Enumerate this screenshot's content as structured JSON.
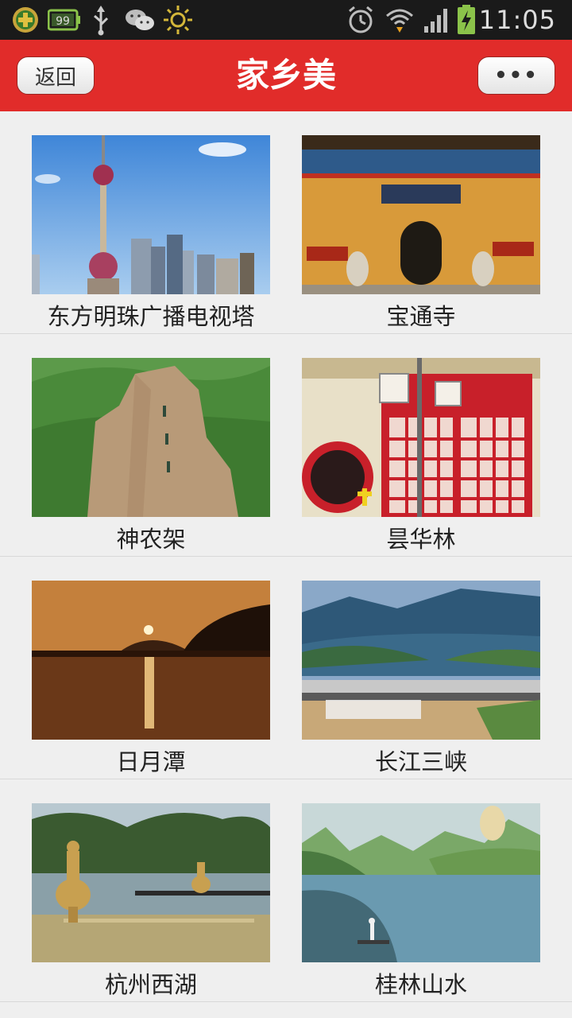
{
  "status_bar": {
    "time": "11:05",
    "icons": [
      "app-plus-icon",
      "battery-badge-icon",
      "usb-icon",
      "wechat-icon",
      "brightness-icon",
      "alarm-icon",
      "wifi-icon",
      "signal-icon",
      "battery-charging-icon"
    ],
    "badge_number": "99"
  },
  "header": {
    "title": "家乡美",
    "back_label": "返回",
    "more_label": "•••",
    "accent_color": "#e12c2a"
  },
  "places": [
    {
      "name": "东方明珠广播电视塔",
      "image": "pearl-tower-photo"
    },
    {
      "name": "宝通寺",
      "image": "baotong-temple-photo"
    },
    {
      "name": "神农架",
      "image": "shennongjia-rock-photo"
    },
    {
      "name": "昙华林",
      "image": "tanhualin-street-photo"
    },
    {
      "name": "日月潭",
      "image": "sun-moon-lake-photo"
    },
    {
      "name": "长江三峡",
      "image": "three-gorges-dam-photo"
    },
    {
      "name": "杭州西湖",
      "image": "west-lake-pagoda-photo"
    },
    {
      "name": "桂林山水",
      "image": "guilin-river-photo"
    }
  ]
}
